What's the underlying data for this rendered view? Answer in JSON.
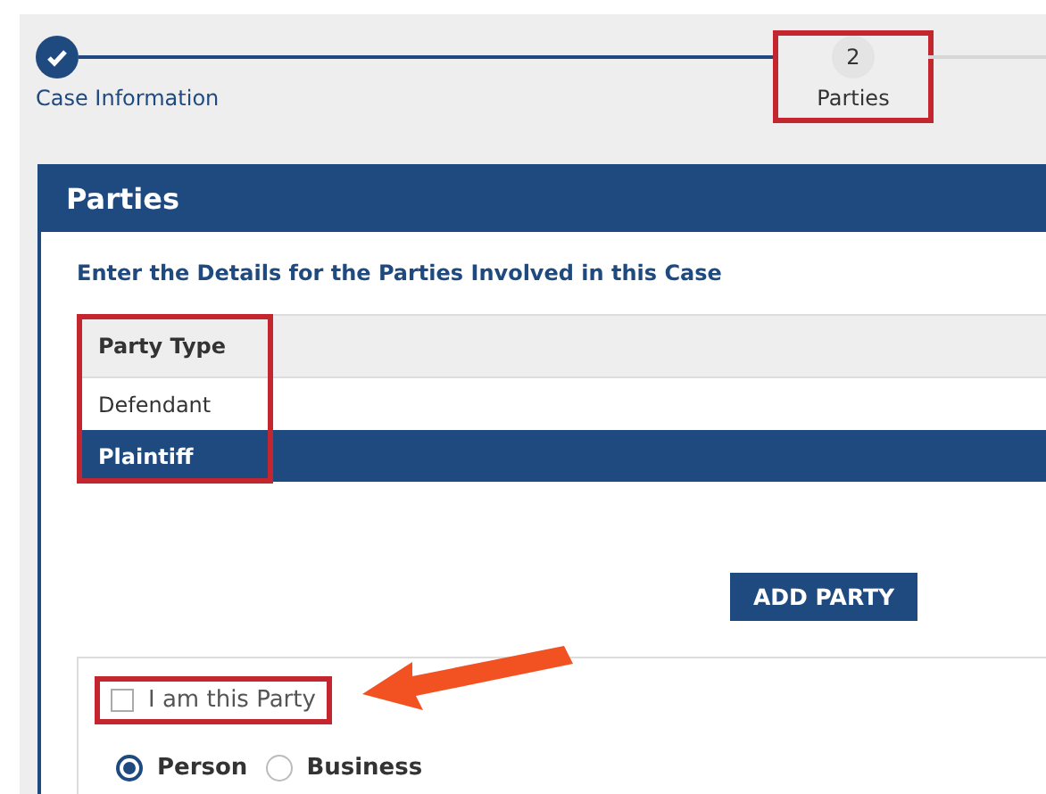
{
  "stepper": {
    "steps": [
      {
        "label": "Case Information",
        "completed": true,
        "selected": false,
        "highlighted": false
      },
      {
        "label": "Parties",
        "number": "2",
        "completed": false,
        "selected": true,
        "highlighted": true
      }
    ]
  },
  "panel": {
    "title": "Parties",
    "subtitle": "Enter the Details for the Parties Involved in this Case",
    "table": {
      "columns": [
        {
          "label": "Party Type",
          "highlighted": true
        }
      ],
      "rows": [
        {
          "cells": [
            "Defendant"
          ],
          "selected": false
        },
        {
          "cells": [
            "Plaintiff"
          ],
          "selected": true
        }
      ]
    },
    "add_button": "ADD PARTY",
    "form": {
      "checkbox": {
        "label": "I am this Party",
        "checked": false,
        "highlighted": true,
        "pointed_at": true
      },
      "radios": [
        {
          "label": "Person",
          "selected": true
        },
        {
          "label": "Business",
          "selected": false
        }
      ]
    }
  }
}
